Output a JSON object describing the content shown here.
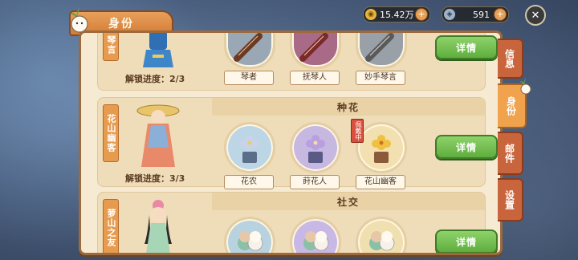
{
  "header": {
    "title": "身份"
  },
  "currency": {
    "coins": "15.42万",
    "gems": "591"
  },
  "sections": [
    {
      "identity_tag": "琴言",
      "category": "",
      "progress": "解锁进度：2/3",
      "items": [
        {
          "label": "琴者"
        },
        {
          "label": "抚琴人"
        },
        {
          "label": "妙手琴言"
        }
      ],
      "detail_label": "详情"
    },
    {
      "identity_tag": "花山幽客",
      "category": "种花",
      "progress": "解锁进度：3/3",
      "wearing": "佩戴中",
      "items": [
        {
          "label": "花农"
        },
        {
          "label": "莳花人"
        },
        {
          "label": "花山幽客"
        }
      ],
      "detail_label": "详情"
    },
    {
      "identity_tag": "萝山之友",
      "category": "社交",
      "progress": "",
      "items": [
        {
          "label": ""
        },
        {
          "label": ""
        },
        {
          "label": ""
        }
      ],
      "detail_label": "详情"
    }
  ],
  "side_tabs": [
    {
      "label": "信息"
    },
    {
      "label": "身份"
    },
    {
      "label": "邮件"
    },
    {
      "label": "设置"
    }
  ],
  "icons": {
    "close": "close-icon",
    "coin": "coin-icon",
    "gem": "gem-icon",
    "plus": "plus-icon"
  }
}
